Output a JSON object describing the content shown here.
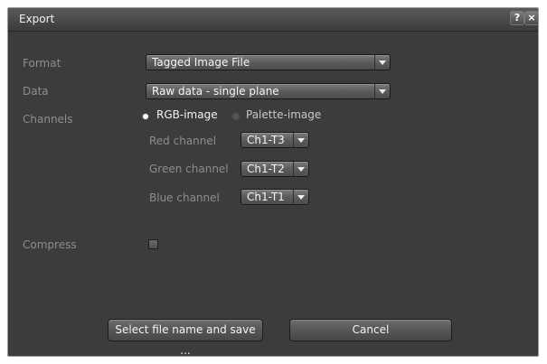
{
  "window": {
    "title": "Export",
    "help_label": "?",
    "close_label": "×"
  },
  "form": {
    "format": {
      "label": "Format",
      "value": "Tagged Image File"
    },
    "data": {
      "label": "Data",
      "value": "Raw data - single plane"
    },
    "channels": {
      "label": "Channels",
      "options": [
        {
          "label": "RGB-image",
          "selected": true
        },
        {
          "label": "Palette-image",
          "selected": false
        }
      ],
      "red": {
        "label": "Red channel",
        "value": "Ch1-T3"
      },
      "green": {
        "label": "Green channel",
        "value": "Ch1-T2"
      },
      "blue": {
        "label": "Blue channel",
        "value": "Ch1-T1"
      }
    },
    "compress": {
      "label": "Compress",
      "checked": false
    }
  },
  "actions": {
    "save_label": "Select file name and save ...",
    "cancel_label": "Cancel"
  },
  "colors": {
    "dialog_bg": "#3c3c3c",
    "label_text": "#8d8d8d",
    "control_text": "#f5f5f5"
  }
}
